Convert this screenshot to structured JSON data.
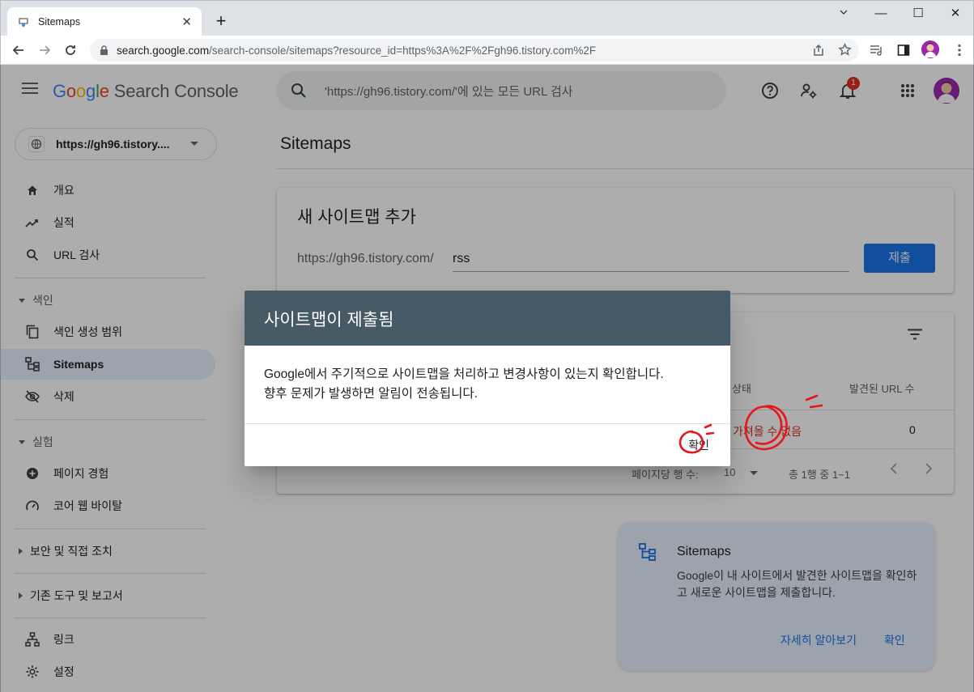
{
  "browser": {
    "tab_title": "Sitemaps",
    "new_tab": "+",
    "url_host": "search.google.com",
    "url_path": "/search-console/sitemaps?resource_id=https%3A%2F%2Fgh96.tistory.com%2F",
    "window_controls": {
      "minimize": "—",
      "maximize": "☐",
      "close": "✕"
    }
  },
  "header": {
    "logo_google": [
      "G",
      "o",
      "o",
      "g",
      "l",
      "e"
    ],
    "logo_product": "Search Console",
    "search_placeholder": "'https://gh96.tistory.com/'에 있는 모든 URL 검사",
    "notification_count": "1"
  },
  "sidebar": {
    "property": "https://gh96.tistory....",
    "items_top": [
      {
        "label": "개요",
        "icon": "home-icon"
      },
      {
        "label": "실적",
        "icon": "trending-icon"
      },
      {
        "label": "URL 검사",
        "icon": "search-icon"
      }
    ],
    "section_index": "색인",
    "items_index": [
      {
        "label": "색인 생성 범위",
        "icon": "copy-icon"
      },
      {
        "label": "Sitemaps",
        "icon": "sitemap-icon",
        "active": true
      },
      {
        "label": "삭제",
        "icon": "eye-off-icon"
      }
    ],
    "section_experience": "실험",
    "items_experience": [
      {
        "label": "페이지 경험",
        "icon": "plus-circle-icon"
      },
      {
        "label": "코어 웹 바이탈",
        "icon": "gauge-icon"
      }
    ],
    "section_security": "보안 및 직접 조치",
    "section_legacy": "기존 도구 및 보고서",
    "items_bottom": [
      {
        "label": "링크",
        "icon": "links-icon"
      },
      {
        "label": "설정",
        "icon": "settings-icon"
      }
    ]
  },
  "main": {
    "title": "Sitemaps",
    "add_card": {
      "title": "새 사이트맵 추가",
      "prefix": "https://gh96.tistory.com/",
      "input_value": "rss",
      "submit_label": "제출"
    },
    "list_card": {
      "col_status": "상태",
      "col_urls": "발견된 URL 수",
      "row_status": "가져올 수 없음",
      "row_count": "0",
      "rows_per_page_label": "페이지당 행 수:",
      "rows_per_page_value": "10",
      "range": "총 1행 중 1~1"
    },
    "info_card": {
      "title": "Sitemaps",
      "description": "Google이 내 사이트에서 발견한 사이트맵을 확인하고 새로운 사이트맵을 제출합니다.",
      "learn_more": "자세히 알아보기",
      "ok": "확인"
    }
  },
  "dialog": {
    "title": "사이트맵이 제출됨",
    "body_line1": "Google에서 주기적으로 사이트맵을 처리하고 변경사항이 있는지 확인합니다.",
    "body_line2": "향후 문제가 발생하면 알림이 전송됩니다.",
    "ok_label": "확인"
  },
  "colors": {
    "dialog_header": "#455a64",
    "accent_blue": "#1a73e8",
    "error_red": "#d93025",
    "annotation_red": "#e8151b"
  }
}
